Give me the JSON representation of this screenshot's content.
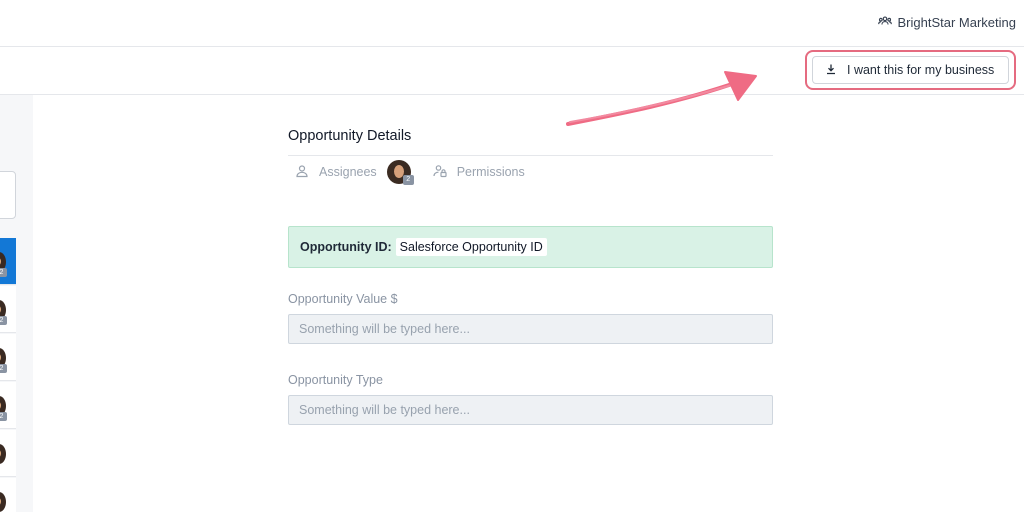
{
  "header": {
    "org_name": "BrightStar Marketing",
    "org_icon": "users-icon"
  },
  "toolbar": {
    "cta_label": "I want this for my business",
    "cta_icon": "download-icon",
    "highlight_color": "#e56b80"
  },
  "panel": {
    "title": "Opportunity Details",
    "tabs": {
      "assignees_label": "Assignees",
      "assignee_count": "2",
      "permissions_label": "Permissions"
    },
    "opportunity_id": {
      "label": "Opportunity ID:",
      "value": "Salesforce Opportunity ID"
    },
    "fields": [
      {
        "label": "Opportunity Value $",
        "placeholder": "Something will be typed here..."
      },
      {
        "label": "Opportunity Type",
        "placeholder": "Something will be typed here..."
      }
    ]
  },
  "sidebar": {
    "items": [
      {
        "badge": "2",
        "active": true
      },
      {
        "badge": "2",
        "active": false
      },
      {
        "badge": "2",
        "active": false
      },
      {
        "badge": "2",
        "active": false
      },
      {
        "badge": "",
        "active": false
      },
      {
        "badge": "",
        "active": false
      }
    ]
  },
  "colors": {
    "accent_blue": "#1378d6",
    "success_bg": "#d9f2e6"
  }
}
